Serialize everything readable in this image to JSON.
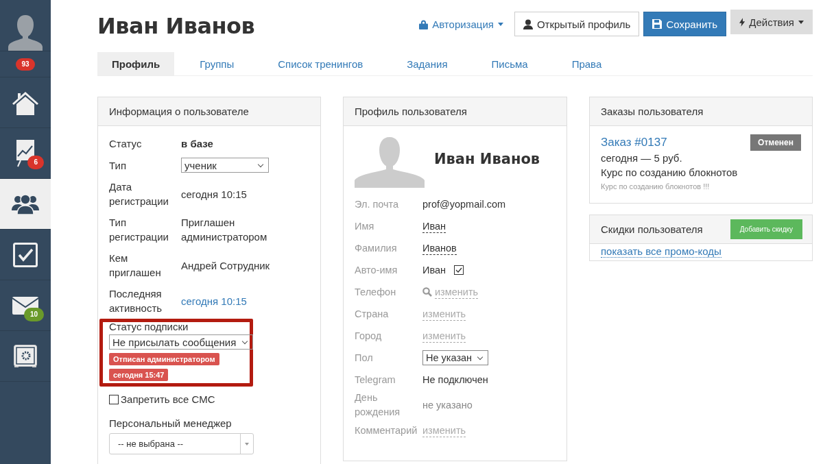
{
  "sidebar": {
    "items": [
      {
        "kind": "avatar",
        "selected": false
      },
      {
        "kind": "counter",
        "selected": false,
        "badge": "93",
        "color": "#d9342b"
      },
      {
        "kind": "home",
        "selected": false
      },
      {
        "kind": "chart",
        "selected": false,
        "badge": "6",
        "color": "#d9342b"
      },
      {
        "kind": "users",
        "selected": true
      },
      {
        "kind": "tasks",
        "selected": false
      },
      {
        "kind": "mail",
        "selected": false,
        "badge": "10",
        "color": "#6a9a2a"
      },
      {
        "kind": "safe",
        "selected": false
      }
    ]
  },
  "header": {
    "title": "Иван Иванов",
    "auth_link": "Авторизация",
    "buttons": [
      {
        "kind": "profile",
        "label": "Открытый профиль"
      },
      {
        "kind": "save",
        "label": "Сохранить"
      },
      {
        "kind": "actions",
        "label": "Действия"
      }
    ]
  },
  "tabs": [
    {
      "label": "Профиль",
      "selected": true
    },
    {
      "label": "Группы",
      "selected": false
    },
    {
      "label": "Список тренингов",
      "selected": false
    },
    {
      "label": "Задания",
      "selected": false
    },
    {
      "label": "Письма",
      "selected": false
    },
    {
      "label": "Права",
      "selected": false
    }
  ],
  "user_info": {
    "title": "Информация о пользователе",
    "rows": [
      {
        "label": "Статус",
        "value": "в базе",
        "kind": "bold"
      },
      {
        "label": "Тип",
        "value": "ученик",
        "kind": "select"
      },
      {
        "label": "Дата регистрации",
        "value": "сегодня 10:15",
        "kind": "text"
      },
      {
        "label": "Тип регистрации",
        "value": "Приглашен администратором",
        "kind": "text"
      },
      {
        "label": "Кем приглашен",
        "value": "Андрей Сотрудник",
        "kind": "text"
      },
      {
        "label": "Последняя активность",
        "value": "сегодня 10:15",
        "kind": "link"
      }
    ],
    "subscription": {
      "label": "Статус подписки",
      "value": "Не присылать сообщения",
      "highlighted": true,
      "tags": [
        "Отписан администратором",
        "сегодня 15:47"
      ]
    },
    "sms": {
      "label": "Запретить все СМС",
      "checked": false
    },
    "manager": {
      "label": "Персональный менеджер",
      "value": "-- не выбрана --"
    }
  },
  "profile": {
    "title": "Профиль пользователя",
    "name": "Иван Иванов",
    "fields": [
      {
        "label": "Эл. почта",
        "value": "prof@yopmail.com",
        "kind": "text"
      },
      {
        "label": "Имя",
        "value": "Иван",
        "kind": "editable"
      },
      {
        "label": "Фамилия",
        "value": "Иванов",
        "kind": "editable"
      },
      {
        "label": "Авто-имя",
        "value": "Иван",
        "kind": "check",
        "checked": true
      },
      {
        "label": "Телефон",
        "value": "изменить",
        "kind": "search_link"
      },
      {
        "label": "Страна",
        "value": "изменить",
        "kind": "link"
      },
      {
        "label": "Город",
        "value": "изменить",
        "kind": "link"
      },
      {
        "label": "Пол",
        "value": "Не указан",
        "kind": "select"
      },
      {
        "label": "Telegram",
        "value": "Не подключен",
        "kind": "text"
      },
      {
        "label": "День рождения",
        "value": "не указано",
        "kind": "muted"
      },
      {
        "label": "Комментарий",
        "value": "изменить",
        "kind": "link"
      }
    ]
  },
  "orders": {
    "title": "Заказы пользователя",
    "items": [
      {
        "number": "Заказ #0137",
        "status": "Отменен",
        "summary": "сегодня — 5 руб.",
        "product": "Курс по созданию блокнотов",
        "note": "Курс по созданию блокнотов !!!"
      }
    ]
  },
  "discounts": {
    "title": "Скидки пользователя",
    "button": "Добавить скидку",
    "link": "показать все промо-коды"
  }
}
